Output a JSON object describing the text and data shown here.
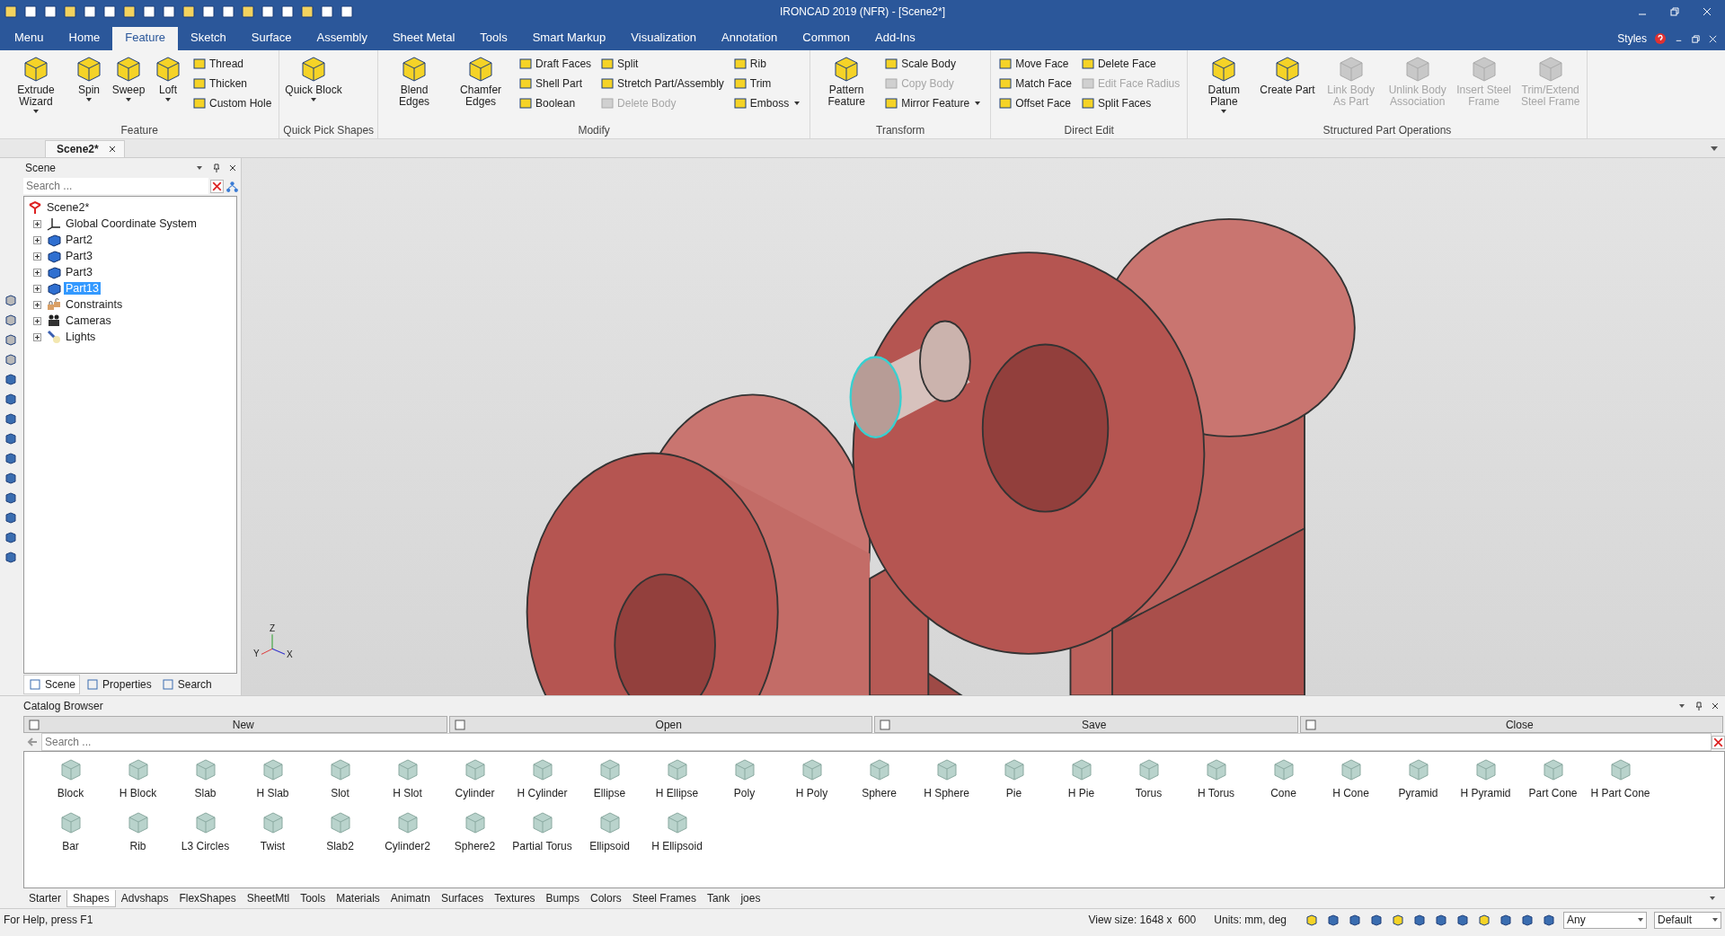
{
  "window": {
    "title": "IRONCAD 2019 (NFR) - [Scene2*]"
  },
  "menu_tabs": [
    {
      "label": "Menu",
      "selected": false
    },
    {
      "label": "Home",
      "selected": false
    },
    {
      "label": "Feature",
      "selected": true
    },
    {
      "label": "Sketch",
      "selected": false
    },
    {
      "label": "Surface",
      "selected": false
    },
    {
      "label": "Assembly",
      "selected": false
    },
    {
      "label": "Sheet Metal",
      "selected": false
    },
    {
      "label": "Tools",
      "selected": false
    },
    {
      "label": "Smart Markup",
      "selected": false
    },
    {
      "label": "Visualization",
      "selected": false
    },
    {
      "label": "Annotation",
      "selected": false
    },
    {
      "label": "Common",
      "selected": false
    },
    {
      "label": "Add-Ins",
      "selected": false
    }
  ],
  "styles_label": "Styles",
  "ribbon": {
    "groups": [
      {
        "label": "Feature",
        "items": [
          {
            "kind": "large",
            "label": "Extrude Wizard",
            "dropdown": true,
            "disabled": false
          },
          {
            "kind": "large",
            "label": "Spin",
            "dropdown": true,
            "disabled": false
          },
          {
            "kind": "large",
            "label": "Sweep",
            "dropdown": true,
            "disabled": false
          },
          {
            "kind": "large",
            "label": "Loft",
            "dropdown": true,
            "disabled": false
          },
          {
            "kind": "stack",
            "tools": [
              {
                "label": "Thread",
                "dropdown": false,
                "disabled": false
              },
              {
                "label": "Thicken",
                "dropdown": false,
                "disabled": false
              },
              {
                "label": "Custom Hole",
                "dropdown": false,
                "disabled": false
              }
            ]
          }
        ]
      },
      {
        "label": "Quick Pick Shapes",
        "items": [
          {
            "kind": "large",
            "label": "Quick Block",
            "dropdown": true,
            "disabled": false
          }
        ]
      },
      {
        "label": "Modify",
        "items": [
          {
            "kind": "large",
            "label": "Blend Edges",
            "dropdown": false,
            "disabled": false
          },
          {
            "kind": "large",
            "label": "Chamfer Edges",
            "dropdown": false,
            "disabled": false
          },
          {
            "kind": "stack",
            "tools": [
              {
                "label": "Draft Faces",
                "dropdown": false,
                "disabled": false
              },
              {
                "label": "Shell Part",
                "dropdown": false,
                "disabled": false
              },
              {
                "label": "Boolean",
                "dropdown": false,
                "disabled": false
              }
            ]
          },
          {
            "kind": "stack",
            "tools": [
              {
                "label": "Split",
                "dropdown": false,
                "disabled": false
              },
              {
                "label": "Stretch Part/Assembly",
                "dropdown": false,
                "disabled": false
              },
              {
                "label": "Delete Body",
                "dropdown": false,
                "disabled": true
              }
            ]
          },
          {
            "kind": "stack",
            "tools": [
              {
                "label": "Rib",
                "dropdown": false,
                "disabled": false
              },
              {
                "label": "Trim",
                "dropdown": false,
                "disabled": false
              },
              {
                "label": "Emboss",
                "dropdown": true,
                "disabled": false
              }
            ]
          }
        ]
      },
      {
        "label": "Transform",
        "items": [
          {
            "kind": "large",
            "label": "Pattern Feature",
            "dropdown": false,
            "disabled": false
          },
          {
            "kind": "stack",
            "tools": [
              {
                "label": "Scale Body",
                "dropdown": false,
                "disabled": false
              },
              {
                "label": "Copy Body",
                "dropdown": false,
                "disabled": true
              },
              {
                "label": "Mirror Feature",
                "dropdown": true,
                "disabled": false
              }
            ]
          }
        ]
      },
      {
        "label": "Direct Edit",
        "items": [
          {
            "kind": "stack",
            "tools": [
              {
                "label": "Move Face",
                "dropdown": false,
                "disabled": false
              },
              {
                "label": "Match Face",
                "dropdown": false,
                "disabled": false
              },
              {
                "label": "Offset Face",
                "dropdown": false,
                "disabled": false
              }
            ]
          },
          {
            "kind": "stack",
            "tools": [
              {
                "label": "Delete Face",
                "dropdown": false,
                "disabled": false
              },
              {
                "label": "Edit Face Radius",
                "dropdown": false,
                "disabled": true
              },
              {
                "label": "Split Faces",
                "dropdown": false,
                "disabled": false
              }
            ]
          }
        ]
      },
      {
        "label": "Structured Part Operations",
        "items": [
          {
            "kind": "large",
            "label": "Datum Plane",
            "dropdown": true,
            "disabled": false
          },
          {
            "kind": "large",
            "label": "Create Part",
            "dropdown": false,
            "disabled": false
          },
          {
            "kind": "large",
            "label": "Link Body As Part",
            "dropdown": false,
            "disabled": true
          },
          {
            "kind": "large",
            "label": "Unlink Body Association",
            "dropdown": false,
            "disabled": true
          },
          {
            "kind": "large",
            "label": "Insert Steel Frame",
            "dropdown": false,
            "disabled": true
          },
          {
            "kind": "large",
            "label": "Trim/Extend Steel Frame",
            "dropdown": false,
            "disabled": true
          }
        ]
      }
    ]
  },
  "document_tab": {
    "label": "Scene2*"
  },
  "scene_panel": {
    "title": "Scene",
    "search": {
      "placeholder": "Search ..."
    },
    "tree": {
      "label": "Scene2*",
      "children": [
        {
          "label": "Global Coordinate System",
          "kind": "axes",
          "expanded": false,
          "selected": false
        },
        {
          "label": "Part2",
          "kind": "part",
          "expanded": false,
          "selected": false
        },
        {
          "label": "Part3",
          "kind": "part",
          "expanded": false,
          "selected": false
        },
        {
          "label": "Part3",
          "kind": "part",
          "expanded": false,
          "selected": false
        },
        {
          "label": "Part13",
          "kind": "part",
          "expanded": false,
          "selected": true
        },
        {
          "label": "Constraints",
          "kind": "constraints",
          "expanded": false,
          "selected": false
        },
        {
          "label": "Cameras",
          "kind": "cameras",
          "expanded": false,
          "selected": false
        },
        {
          "label": "Lights",
          "kind": "lights",
          "expanded": false,
          "selected": false
        }
      ]
    },
    "tabs": [
      {
        "label": "Scene",
        "selected": true
      },
      {
        "label": "Properties",
        "selected": false
      },
      {
        "label": "Search",
        "selected": false
      }
    ]
  },
  "viewport": {
    "triad": {
      "z": "Z",
      "y": "Y",
      "x": "X"
    }
  },
  "catalog": {
    "title": "Catalog Browser",
    "actions": [
      "New",
      "Open",
      "Save",
      "Close"
    ],
    "search": {
      "placeholder": "Search ..."
    },
    "shape_rows": [
      {
        "items": [
          "Block",
          "H Block",
          "Slab",
          "H Slab",
          "Slot",
          "H Slot",
          "Cylinder",
          "H Cylinder",
          "Ellipse",
          "H Ellipse",
          "Poly",
          "H Poly",
          "Sphere",
          "H Sphere",
          "Pie",
          "H Pie",
          "Torus",
          "H Torus",
          "Cone",
          "H Cone",
          "Pyramid",
          "H Pyramid",
          "Part Cone",
          "H Part Cone"
        ]
      },
      {
        "items": [
          "Bar",
          "Rib",
          "L3 Circles",
          "Twist",
          "Slab2",
          "Cylinder2",
          "Sphere2",
          "Partial Torus",
          "Ellipsoid",
          "H Ellipsoid"
        ]
      }
    ],
    "tabs": [
      {
        "label": "Starter",
        "selected": false
      },
      {
        "label": "Shapes",
        "selected": true
      },
      {
        "label": "Advshaps",
        "selected": false
      },
      {
        "label": "FlexShapes",
        "selected": false
      },
      {
        "label": "SheetMtl",
        "selected": false
      },
      {
        "label": "Tools",
        "selected": false
      },
      {
        "label": "Materials",
        "selected": false
      },
      {
        "label": "Animatn",
        "selected": false
      },
      {
        "label": "Surfaces",
        "selected": false
      },
      {
        "label": "Textures",
        "selected": false
      },
      {
        "label": "Bumps",
        "selected": false
      },
      {
        "label": "Colors",
        "selected": false
      },
      {
        "label": "Steel Frames",
        "selected": false
      },
      {
        "label": "Tank",
        "selected": false
      },
      {
        "label": "joes",
        "selected": false
      }
    ]
  },
  "status_bar": {
    "help": "For Help, press F1",
    "view_size": "View size: 1648 x  600",
    "units": "Units: mm, deg",
    "filter": "Any",
    "style": "Default"
  }
}
